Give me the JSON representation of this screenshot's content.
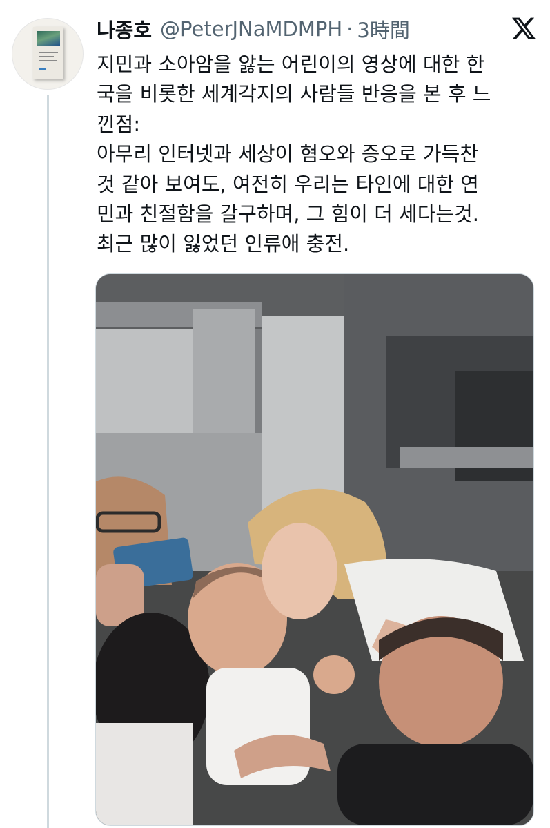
{
  "tweet": {
    "author_name": "나종호",
    "author_handle": "@PeterJNaMDMPH",
    "separator": "·",
    "time": "3時間",
    "text_lines": [
      "지민과 소아암을 앓는 어린이의 영상에 대한 한",
      "국을 비롯한 세계각지의 사람들 반응을 본 후 느",
      "낀점:",
      "아무리 인터넷과 세상이 혐오와 증오로 가득찬",
      "것 같아 보여도, 여전히 우리는 타인에 대한 연",
      "민과 친절함을 갈구하며, 그 힘이 더 세다는것.",
      "최근 많이 잃었던 인류애 충전."
    ],
    "avatar_icon": "book-cover-avatar",
    "brand_icon": "x-logo-icon",
    "media_icon": "concert-photo"
  }
}
